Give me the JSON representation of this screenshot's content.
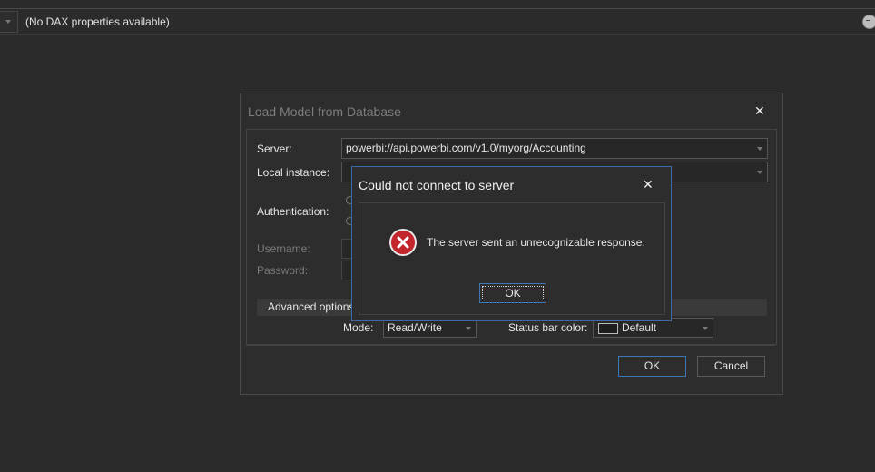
{
  "top_bar": {
    "dax_properties_label": "(No DAX properties available)",
    "dropdown_icon": "chevron-down-icon",
    "right_button_icon": "collapse-circle-icon"
  },
  "load_dialog": {
    "title": "Load Model from Database",
    "close_glyph": "✕",
    "server_label": "Server:",
    "server_value": "powerbi://api.powerbi.com/v1.0/myorg/Accounting",
    "local_instance_label": "Local instance:",
    "local_instance_value": "",
    "authentication_label": "Authentication:",
    "username_label": "Username:",
    "password_label": "Password:",
    "advanced_options_label": "Advanced options",
    "mode_label": "Mode:",
    "mode_value": "Read/Write",
    "status_bar_color_label": "Status bar color:",
    "status_bar_color_value": "Default",
    "ok_label": "OK",
    "cancel_label": "Cancel"
  },
  "error_dialog": {
    "title": "Could not connect to server",
    "close_glyph": "✕",
    "icon": "error-x-icon",
    "message": "The server sent an unrecognizable response.",
    "ok_label": "OK"
  },
  "colors": {
    "background": "#2b2b2b",
    "dialog": "#2d2d2d",
    "accent_border": "#3b6aa8",
    "error_red": "#c4262e"
  }
}
